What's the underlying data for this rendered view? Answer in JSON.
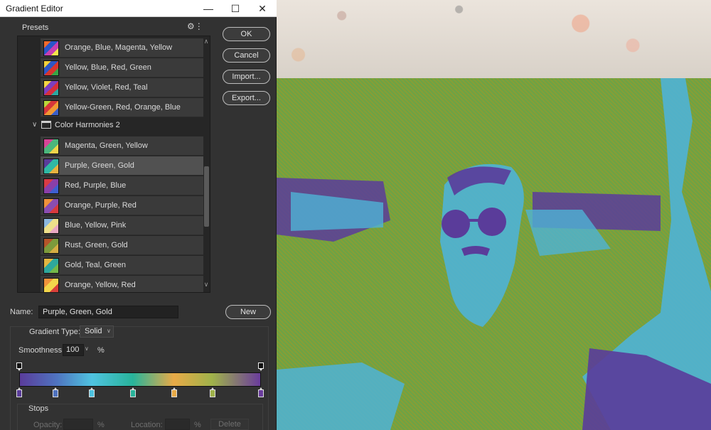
{
  "window": {
    "title": "Gradient Editor"
  },
  "presets": {
    "label": "Presets",
    "items": [
      {
        "label": "Orange, Blue, Magenta, Yellow",
        "swatch": [
          "#f36a2c",
          "#2a55c8",
          "#c93fb0",
          "#f7e54a"
        ]
      },
      {
        "label": "Yellow, Blue, Red, Green",
        "swatch": [
          "#f6d23a",
          "#2f56c4",
          "#d8352e",
          "#39a547"
        ]
      },
      {
        "label": "Yellow, Violet, Red, Teal",
        "swatch": [
          "#f5d742",
          "#7d3fbf",
          "#d6303c",
          "#2aa9a1"
        ]
      },
      {
        "label": "Yellow-Green, Red, Orange, Blue",
        "swatch": [
          "#b9d73a",
          "#d7363a",
          "#f19934",
          "#3b5fc8"
        ]
      }
    ],
    "folder": {
      "label": "Color Harmonies 2"
    },
    "folder_items": [
      {
        "label": "Magenta, Green, Yellow",
        "swatch": [
          "#d74597",
          "#4bb67c",
          "#f0d44a"
        ]
      },
      {
        "label": "Purple, Green, Gold",
        "swatch": [
          "#5a3c9a",
          "#2fb8a4",
          "#e6b13f"
        ]
      },
      {
        "label": "Red, Purple, Blue",
        "swatch": [
          "#d93b44",
          "#8a3fa8",
          "#3f5fd0"
        ]
      },
      {
        "label": "Orange, Purple, Red",
        "swatch": [
          "#f0923a",
          "#8a4db0",
          "#d83a3e"
        ]
      },
      {
        "label": "Blue, Yellow, Pink",
        "swatch": [
          "#8cb8e0",
          "#ede08a",
          "#e9a7c2"
        ]
      },
      {
        "label": "Rust, Green, Gold",
        "swatch": [
          "#b5552a",
          "#7c9a3c",
          "#d5ac43"
        ]
      },
      {
        "label": "Gold, Teal, Green",
        "swatch": [
          "#e3b741",
          "#2ea79d",
          "#74b74a"
        ]
      },
      {
        "label": "Orange, Yellow, Red",
        "swatch": [
          "#f2933b",
          "#f2d54b",
          "#d9403a"
        ]
      }
    ],
    "selected": "Purple, Green, Gold"
  },
  "buttons": {
    "ok": "OK",
    "cancel": "Cancel",
    "import": "Import...",
    "export": "Export...",
    "new": "New"
  },
  "name": {
    "label": "Name:",
    "value": "Purple, Green, Gold"
  },
  "gradient": {
    "type_label": "Gradient Type:",
    "type_value": "Solid",
    "smoothness_label": "Smoothness:",
    "smoothness_value": "100",
    "smoothness_unit": "%",
    "colors": [
      "#5a3c9a",
      "#4f72bf",
      "#4fc3e0",
      "#28b39a",
      "#e8aa47",
      "#9fb24a",
      "#6a3c9c"
    ],
    "color_stop_locations": [
      0,
      15,
      30,
      47,
      64,
      80,
      100
    ],
    "opacity_stop_locations": [
      0,
      100
    ]
  },
  "stops": {
    "label": "Stops",
    "opacity_label": "Opacity:",
    "opacity_unit": "%",
    "location_label": "Location:",
    "location_unit": "%",
    "delete": "Delete"
  }
}
